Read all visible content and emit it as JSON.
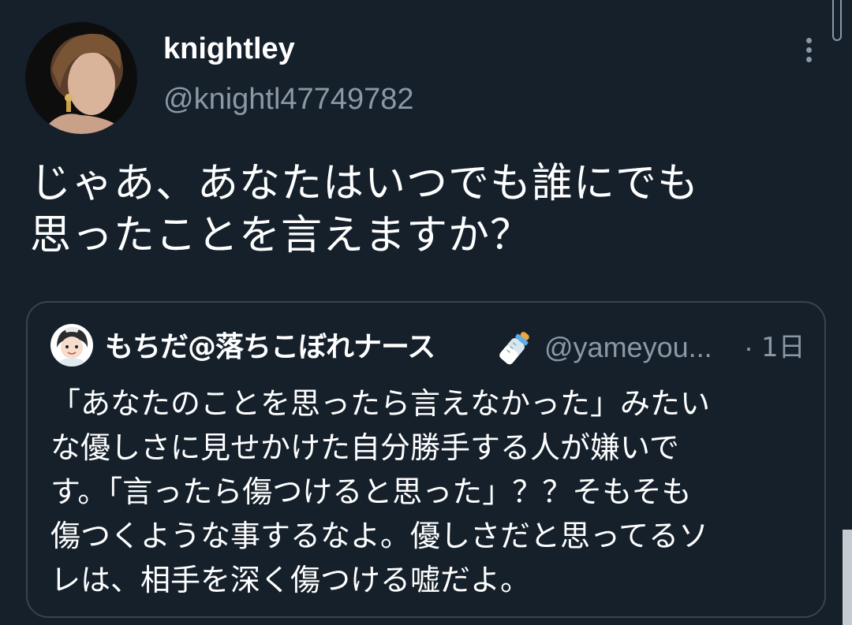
{
  "tweet": {
    "display_name": "knightley",
    "handle": "@knightl47749782",
    "text_lines": [
      "じゃあ、あなたはいつでも誰にでも",
      "思ったことを言えますか？"
    ]
  },
  "quoted_tweet": {
    "display_name": "もちだ@落ちこぼれナース",
    "name_emoji_icon": "baby-bottle-icon",
    "handle": "@yameyou...",
    "separator": "·",
    "time": "1日",
    "text_lines": [
      "「あなたのことを思ったら言えなかった」みたい",
      "な優しさに見せかけた自分勝手する人が嫌いで",
      "す。「言ったら傷つけると思った」？？そもそも",
      "傷つくような事するなよ。優しさだと思ってるソ",
      "レは、相手を深く傷つける嘘だよ。"
    ]
  },
  "colors": {
    "background": "#15202b",
    "primary_text": "#ffffff",
    "secondary_text": "#8b98a5",
    "card_border": "#38444d"
  },
  "icons": {
    "more": "more-vertical-icon"
  }
}
